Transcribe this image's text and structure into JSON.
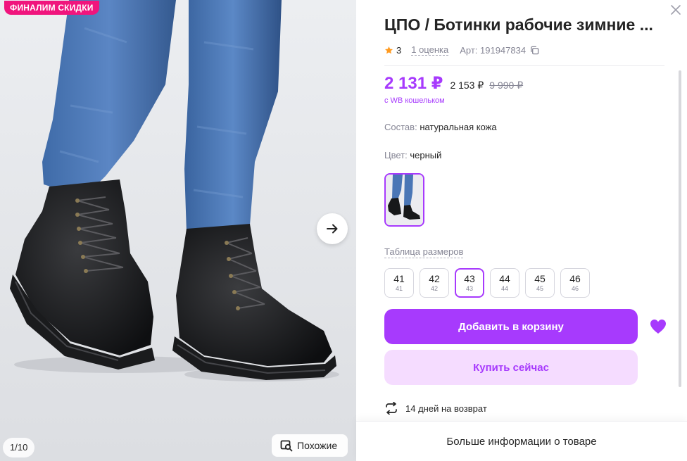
{
  "gallery": {
    "promo_badge": "ФИНАЛИМ СКИДКИ",
    "counter": "1/10",
    "similar_label": "Похожие",
    "icons": {
      "next": "arrow-right-icon",
      "similar": "image-search-icon"
    }
  },
  "product": {
    "title": "ЦПО / Ботинки рабочие зимние ...",
    "rating": "3",
    "reviews": "1 оценка",
    "article": "Арт: 191947834",
    "price": {
      "current": "2 131 ₽",
      "alt": "2 153 ₽",
      "old": "9 990 ₽",
      "wallet_note": "с WB кошельком"
    },
    "composition_label": "Состав:",
    "composition_value": "натуральная кожа",
    "color_label": "Цвет:",
    "color_value": "черный",
    "size_table": "Таблица размеров",
    "sizes": [
      {
        "main": "41",
        "sub": "41"
      },
      {
        "main": "42",
        "sub": "42"
      },
      {
        "main": "43",
        "sub": "43"
      },
      {
        "main": "44",
        "sub": "44"
      },
      {
        "main": "45",
        "sub": "45"
      },
      {
        "main": "46",
        "sub": "46"
      }
    ],
    "selected_size": "43",
    "add_to_cart": "Добавить в корзину",
    "buy_now": "Купить сейчас",
    "return_policy": "14 дней на возврат",
    "more_info": "Больше информации о товаре"
  },
  "colors": {
    "accent": "#a73afd",
    "accent_light": "#f5dcff",
    "promo": "#f0157d",
    "muted_text": "#868695",
    "star": "#ff9a1f"
  }
}
